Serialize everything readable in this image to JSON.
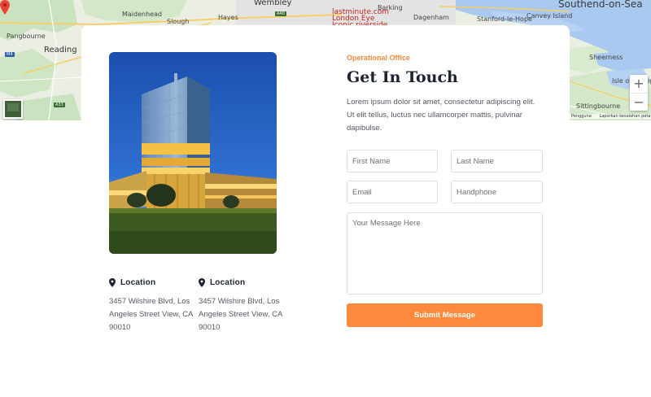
{
  "map": {
    "labels": {
      "wembley": "Wembley",
      "southend": "Southend-on-Sea",
      "maidenhead": "Maidenhead",
      "slough": "Slough",
      "hayes": "Hayes",
      "pangbourne": "Pangbourne",
      "reading": "Reading",
      "stanford": "Stanford-le-Hope",
      "barking": "Barking",
      "dagenham": "Dagenham",
      "canvey": "Canvey Island",
      "sheerness": "Sheerness",
      "isle_of_sheppey": "Isle of Shepp",
      "sittingbourne": "Sittingbourne",
      "landmark_name": "lastminute.com",
      "landmark_sub": "London Eye",
      "landmark_sub2": "Iconic riverside..."
    },
    "zoom_in": "+",
    "zoom_out": "−",
    "attribution": [
      "Pengguna",
      "Laporkan kesalahan peta"
    ]
  },
  "office": {
    "eyebrow": "Operational Office",
    "heading": "Get In Touch",
    "intro": "Lorem ipsum dolor sit amet, consectetur adipiscing elit. Ut elit tellus, luctus nec ullamcorper mattis, pulvinar dapibulse."
  },
  "locations": [
    {
      "title": "Location",
      "address": "3457 Wilshire Blvd, Los Angeles Street View, CA 90010"
    },
    {
      "title": "Location",
      "address": "3457 Wilshire Blvd, Los Angeles Street View, CA 90010"
    }
  ],
  "form": {
    "first_name_placeholder": "First Name",
    "last_name_placeholder": "Last Name",
    "email_placeholder": "Email",
    "phone_placeholder": "Handphone",
    "message_placeholder": "Your Message Here",
    "submit_label": "Submit Message"
  },
  "colors": {
    "accent": "#ff8a3d",
    "heading": "#1e2330",
    "body_text": "#555a63",
    "border": "#dde0e4"
  }
}
